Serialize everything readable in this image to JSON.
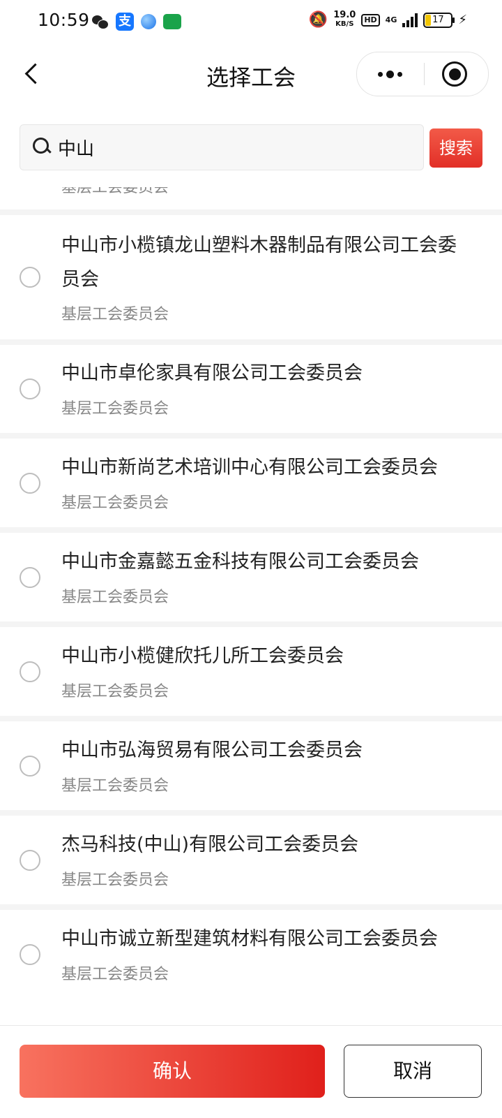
{
  "status_bar": {
    "time": "10:59",
    "net_speed_value": "19.0",
    "net_speed_unit": "KB/S",
    "hd": "HD",
    "network": "4G",
    "battery": "17",
    "icons": [
      "wechat-icon",
      "alipay-icon",
      "browser-icon",
      "oppo-app-icon",
      "mute-bell-icon",
      "signal-icon",
      "battery-icon",
      "charging-icon"
    ]
  },
  "nav": {
    "title": "选择工会"
  },
  "search": {
    "value": "中山",
    "placeholder": "",
    "button_label": "搜索"
  },
  "list": {
    "partial_item_type": "基层工会委员会",
    "items": [
      {
        "name": "中山市小榄镇龙山塑料木器制品有限公司工会委员会",
        "type": "基层工会委员会",
        "selected": false
      },
      {
        "name": "中山市卓伦家具有限公司工会委员会",
        "type": "基层工会委员会",
        "selected": false
      },
      {
        "name": "中山市新尚艺术培训中心有限公司工会委员会",
        "type": "基层工会委员会",
        "selected": false
      },
      {
        "name": "中山市金嘉懿五金科技有限公司工会委员会",
        "type": "基层工会委员会",
        "selected": false
      },
      {
        "name": "中山市小榄健欣托儿所工会委员会",
        "type": "基层工会委员会",
        "selected": false
      },
      {
        "name": "中山市弘海贸易有限公司工会委员会",
        "type": "基层工会委员会",
        "selected": false
      },
      {
        "name": "杰马科技(中山)有限公司工会委员会",
        "type": "基层工会委员会",
        "selected": false
      },
      {
        "name": "中山市诚立新型建筑材料有限公司工会委员会",
        "type": "基层工会委员会",
        "selected": false
      }
    ]
  },
  "footer": {
    "confirm_label": "确认",
    "cancel_label": "取消"
  },
  "colors": {
    "accent": "#e53027",
    "radio_border": "#bdbdbd",
    "sub_text": "#888888"
  }
}
